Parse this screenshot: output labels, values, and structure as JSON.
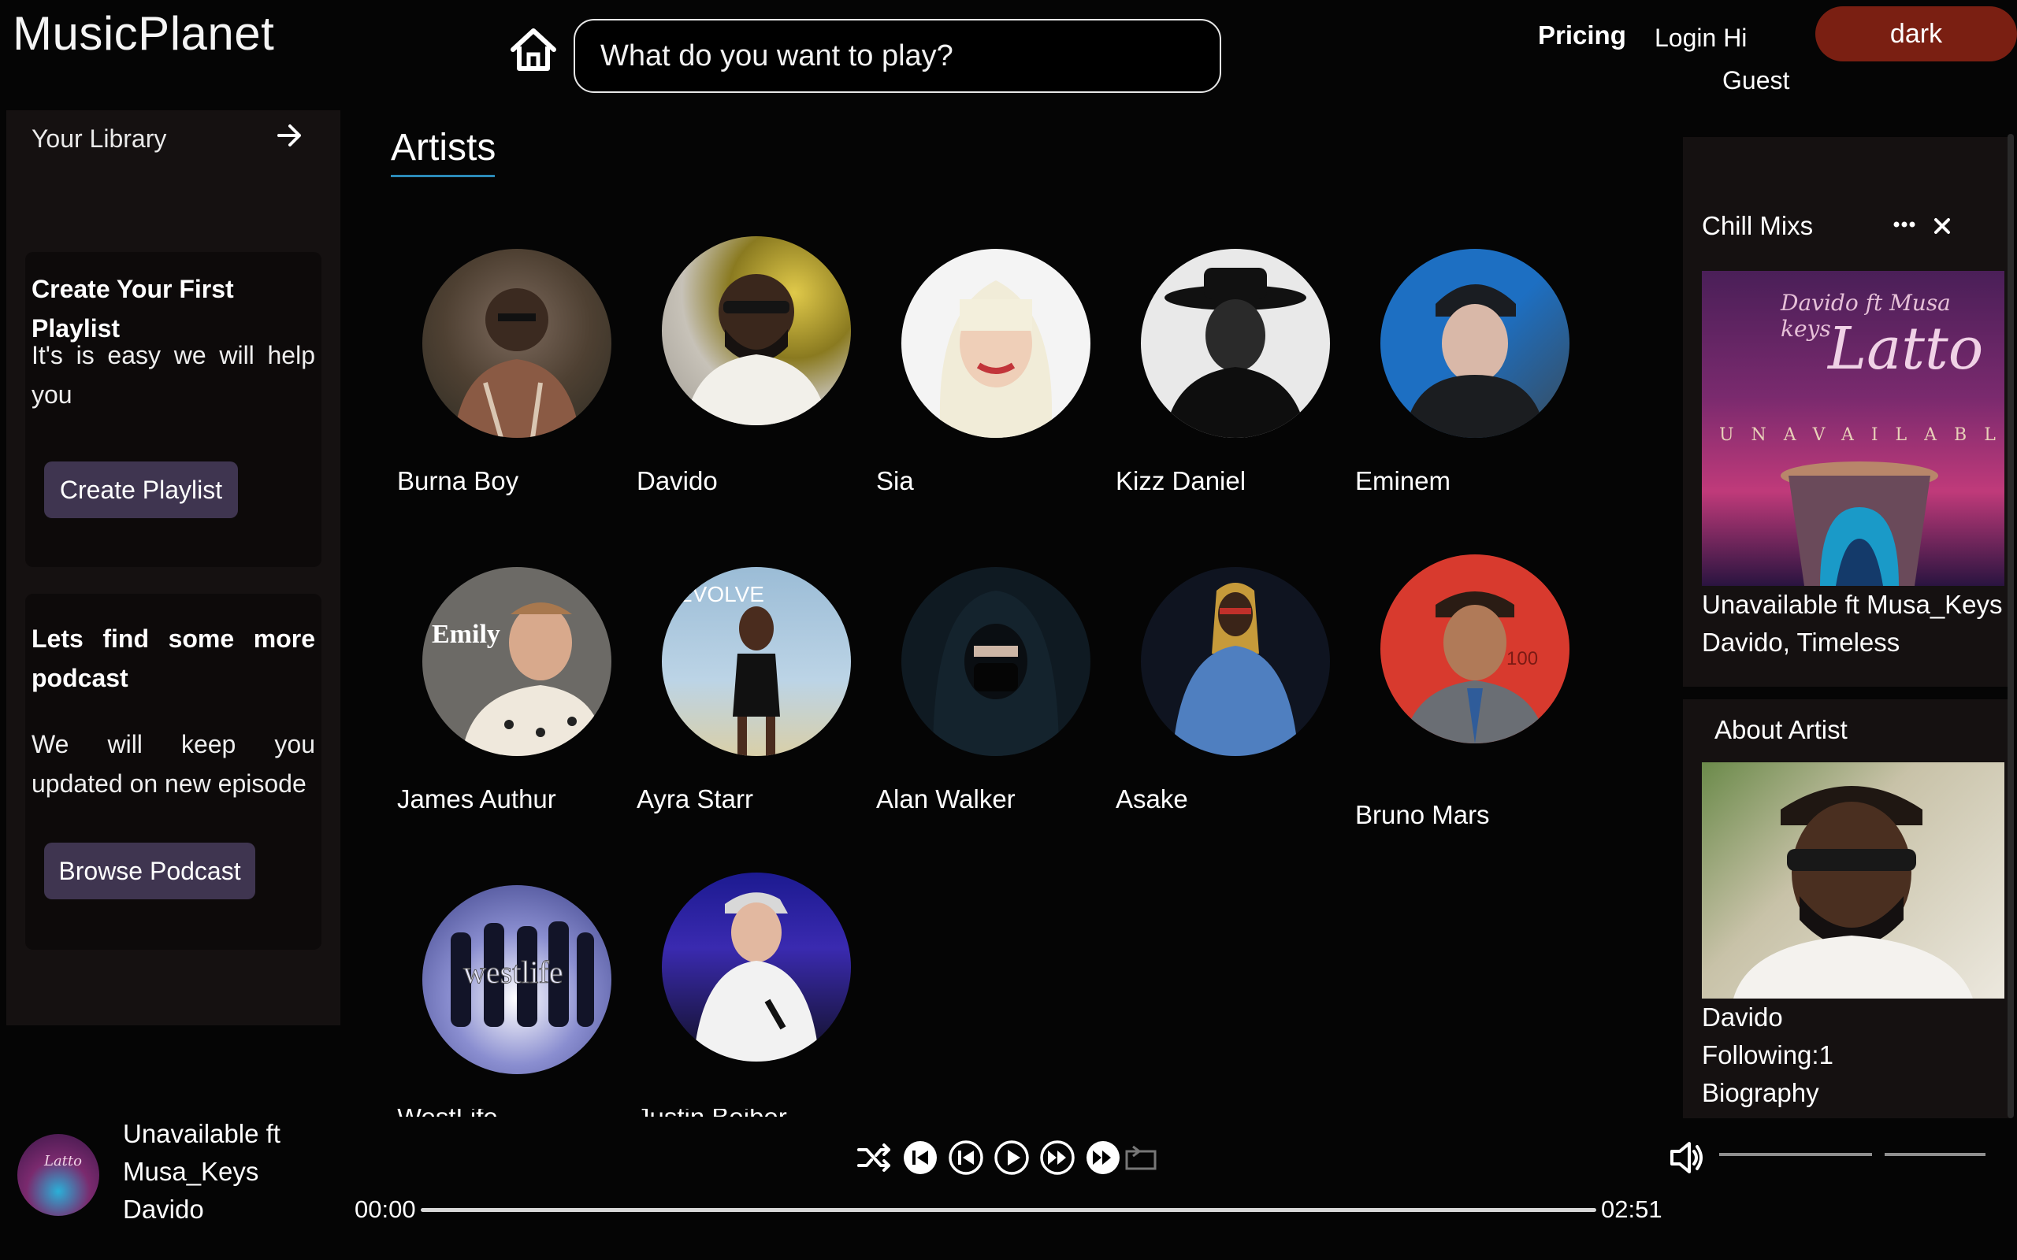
{
  "header": {
    "brand": "MusicPlanet",
    "search_placeholder": "What do you want to play?",
    "nav_pricing": "Pricing",
    "nav_login": "Login Hi",
    "nav_user": "Guest",
    "theme_label": "dark"
  },
  "sidebar": {
    "library_label": "Your Library",
    "playlist_card": {
      "heading": "Create Your First Playlist",
      "text": "It's is easy we will help you",
      "button": "Create Playlist"
    },
    "podcast_card": {
      "heading": "Lets find some more podcast",
      "text": "We will keep you updated on new episode",
      "button": "Browse Podcast"
    }
  },
  "main": {
    "title": "Artists",
    "artists": [
      {
        "name": "Burna Boy"
      },
      {
        "name": "Davido"
      },
      {
        "name": "Sia"
      },
      {
        "name": "Kizz Daniel"
      },
      {
        "name": "Eminem"
      },
      {
        "name": "James Authur"
      },
      {
        "name": "Ayra Starr"
      },
      {
        "name": "Alan Walker"
      },
      {
        "name": "Asake"
      },
      {
        "name": "Bruno Mars"
      },
      {
        "name": "WestLife"
      },
      {
        "name": "Justin Beiber"
      }
    ]
  },
  "right_panel": {
    "chill": {
      "title": "Chill Mixs",
      "cover_top_text": "Davido ft Musa keys",
      "cover_script": "Latto",
      "cover_word": "UNAVAILABLE",
      "song_line1": "Unavailable ft Musa_Keys",
      "song_line2": "Davido, Timeless"
    },
    "about": {
      "title": "About Artist",
      "name": "Davido",
      "following": "Following:1",
      "bio_label": "Biography"
    }
  },
  "player": {
    "title_line1": "Unavailable ft",
    "title_line2": "Musa_Keys",
    "artist": "Davido",
    "time_current": "00:00",
    "time_total": "02:51"
  },
  "colors": {
    "background": "#050505",
    "panel": "#151111",
    "theme_button": "#7a1f12",
    "pill_button": "#3f3550",
    "accent_underline": "#2b8ab8"
  },
  "icons": [
    "home-icon",
    "arrow-right-icon",
    "more-dots-icon",
    "close-icon",
    "shuffle-icon",
    "skip-back-icon",
    "rewind-icon",
    "play-icon",
    "fast-forward-icon",
    "skip-forward-icon",
    "repeat-icon",
    "volume-icon"
  ]
}
